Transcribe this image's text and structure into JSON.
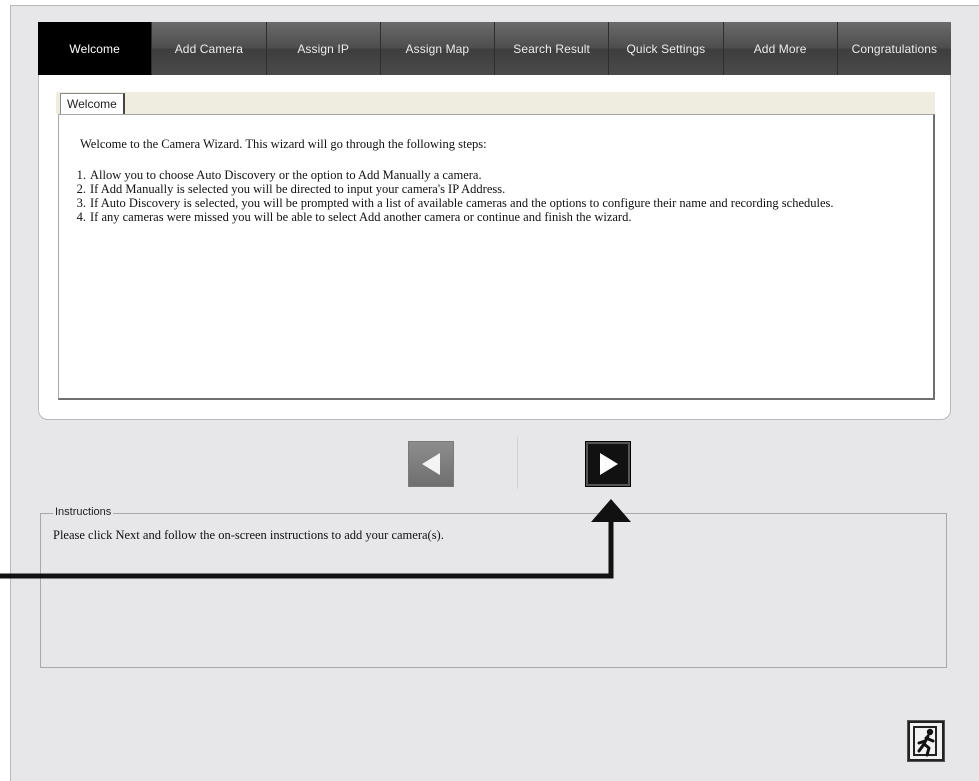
{
  "wizard": {
    "tabs": [
      {
        "label": "Welcome",
        "active": true
      },
      {
        "label": "Add Camera",
        "active": false
      },
      {
        "label": "Assign IP",
        "active": false
      },
      {
        "label": "Assign Map",
        "active": false
      },
      {
        "label": "Search Result",
        "active": false
      },
      {
        "label": "Quick Settings",
        "active": false
      },
      {
        "label": "Add More",
        "active": false
      },
      {
        "label": "Congratulations",
        "active": false
      }
    ],
    "subtab_label": "Welcome",
    "intro": "Welcome to the Camera Wizard. This wizard will go through the following steps:",
    "steps": [
      {
        "num": "1.",
        "text": "Allow you to choose Auto Discovery or the option to Add Manually a camera."
      },
      {
        "num": "2.",
        "text": "If Add Manually is selected you will be directed to input your camera's IP Address."
      },
      {
        "num": "3.",
        "text": "If Auto Discovery is selected, you will be prompted with a list of available cameras and the options to configure their name and recording schedules."
      },
      {
        "num": "4.",
        "text": "If any cameras were missed you will be able to select Add another camera or continue and finish the wizard."
      }
    ]
  },
  "navigation": {
    "back_icon": "triangle-left-icon",
    "next_icon": "triangle-right-icon",
    "back_enabled": false
  },
  "instructions": {
    "legend": "Instructions",
    "text": "Please click Next and follow the on-screen instructions to add your camera(s)."
  },
  "exit": {
    "icon": "exit-running-man-icon"
  },
  "colors": {
    "tab_active": "#000000",
    "tab_inactive": "#4a4a4a",
    "window_bg": "#e7e7ea",
    "subtab_strip": "#efede0"
  }
}
